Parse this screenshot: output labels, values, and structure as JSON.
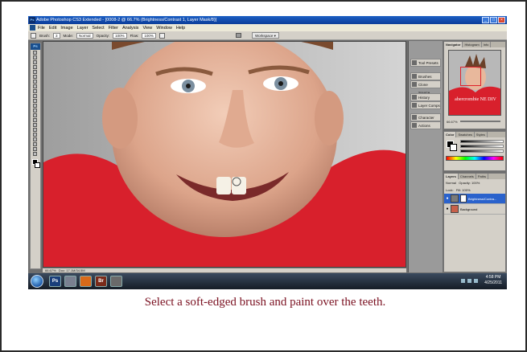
{
  "window": {
    "title": "Adobe Photoshop CS3 Extended - [0008-2 @ 66.7% (Brightness/Contrast 1, Layer Mask/8)]",
    "app_icon": "Ps",
    "buttons": [
      "_",
      "□",
      "×"
    ]
  },
  "menu": [
    "File",
    "Edit",
    "Image",
    "Layer",
    "Select",
    "Filter",
    "Analysis",
    "View",
    "Window",
    "Help"
  ],
  "options_bar": {
    "brush_label": "Brush:",
    "brush_size": "3",
    "mode_label": "Mode:",
    "mode_value": "Normal",
    "opacity_label": "Opacity:",
    "opacity_value": "100%",
    "flow_label": "Flow:",
    "flow_value": "100%",
    "workspace": "Workspace ▾"
  },
  "tools_panel": {
    "header": "Ps"
  },
  "status_bar": {
    "zoom": "66.67%",
    "doc": "Doc: 17.1M/34.5M"
  },
  "dock": [
    {
      "label": "Tool Presets",
      "icon": "tool-presets-icon"
    },
    {
      "label": "Brushes",
      "icon": "brushes-icon"
    },
    {
      "label": "Clone Source",
      "icon": "clone-source-icon"
    },
    {
      "label": "History",
      "icon": "history-icon"
    },
    {
      "label": "Layer Comps",
      "icon": "layer-comps-icon"
    },
    {
      "label": "Character",
      "icon": "character-icon"
    },
    {
      "label": "Actions",
      "icon": "actions-icon"
    }
  ],
  "navigator": {
    "tabs": [
      "Navigator",
      "Histogram",
      "Info"
    ],
    "zoom": "66.67%",
    "thumb_text": "abercrombie NE DIV"
  },
  "color_panel": {
    "tabs": [
      "Color",
      "Swatches",
      "Styles"
    ]
  },
  "layers": {
    "tabs": [
      "Layers",
      "Channels",
      "Paths"
    ],
    "blend": "Normal",
    "opacity_label": "Opacity:",
    "opacity_value": "100%",
    "lock_label": "Lock:",
    "fill_label": "Fill:",
    "fill_value": "100%",
    "items": [
      {
        "name": "Brightness/Contra...",
        "selected": true
      },
      {
        "name": "Background",
        "selected": false
      }
    ]
  },
  "taskbar": {
    "time": "4:58 PM",
    "date": "4/25/2011",
    "apps": [
      "Ps",
      "Br"
    ]
  },
  "caption": "Select a soft-edged brush and paint over the teeth."
}
